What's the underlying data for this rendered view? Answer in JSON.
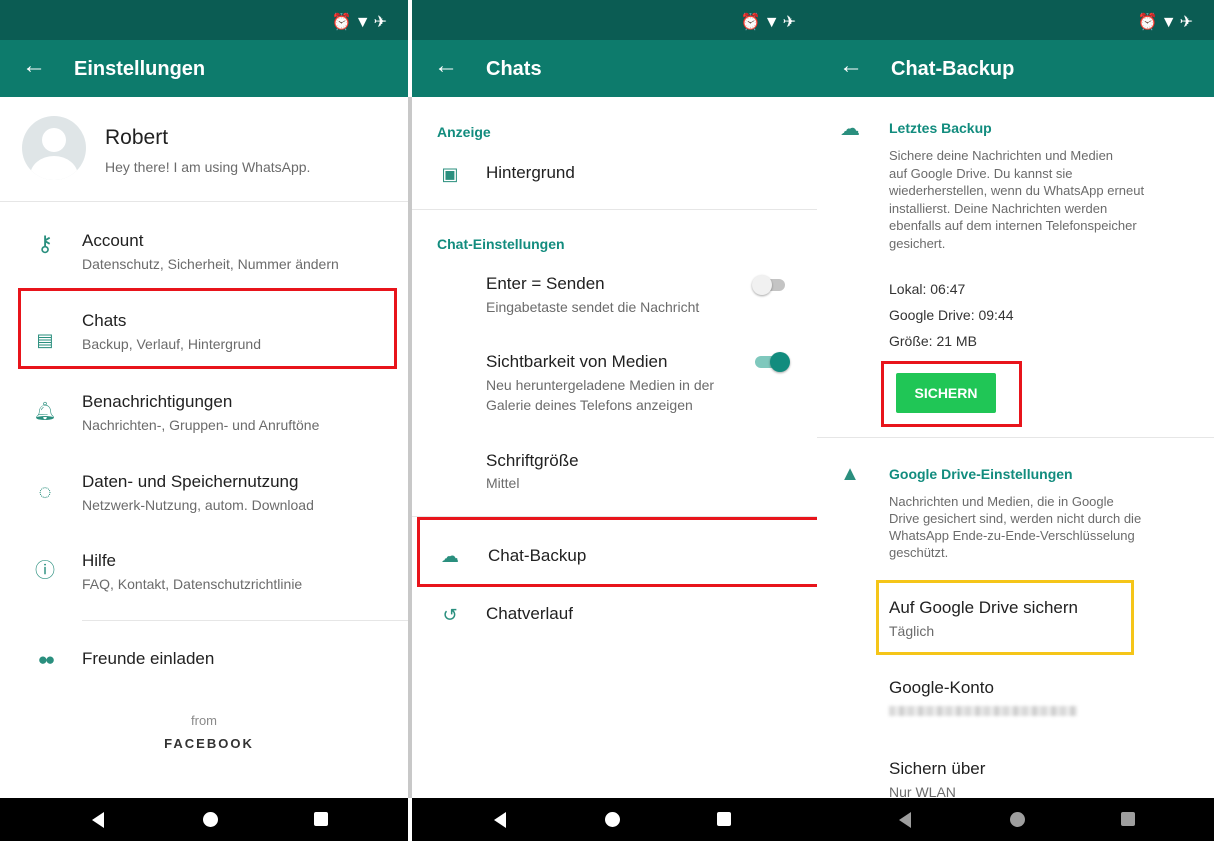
{
  "panel1": {
    "title": "Einstellungen",
    "profile": {
      "name": "Robert",
      "status": "Hey there! I am using WhatsApp."
    },
    "items": [
      {
        "icon": "key-icon",
        "label": "Account",
        "sub": "Datenschutz, Sicherheit, Nummer ändern"
      },
      {
        "icon": "chat-icon",
        "label": "Chats",
        "sub": "Backup, Verlauf, Hintergrund"
      },
      {
        "icon": "bell-icon",
        "label": "Benachrichtigungen",
        "sub": "Nachrichten-, Gruppen- und Anruftöne"
      },
      {
        "icon": "data-usage-icon",
        "label": "Daten- und Speichernutzung",
        "sub": "Netzwerk-Nutzung, autom. Download"
      },
      {
        "icon": "help-icon",
        "label": "Hilfe",
        "sub": "FAQ, Kontakt, Datenschutzrichtlinie"
      }
    ],
    "invite": "Freunde einladen",
    "footer_from": "from",
    "footer_brand": "FACEBOOK"
  },
  "panel2": {
    "title": "Chats",
    "section1": "Anzeige",
    "wallpaper": "Hintergrund",
    "section2": "Chat-Einstellungen",
    "enter_send": {
      "label": "Enter = Senden",
      "sub": "Eingabetaste sendet die Nachricht",
      "on": false
    },
    "media_visibility": {
      "label": "Sichtbarkeit von Medien",
      "sub1": "Neu heruntergeladene Medien in der",
      "sub2": "Galerie deines Telefons anzeigen",
      "on": true
    },
    "font_size": {
      "label": "Schriftgröße",
      "value": "Mittel"
    },
    "backup": "Chat-Backup",
    "history": "Chatverlauf"
  },
  "panel3": {
    "title": "Chat-Backup",
    "last_backup": {
      "heading": "Letztes Backup",
      "desc": [
        "Sichere deine Nachrichten und Medien",
        "auf Google Drive. Du kannst sie",
        "wiederherstellen, wenn du WhatsApp erneut",
        "installierst. Deine Nachrichten werden",
        "ebenfalls auf dem internen Telefonspeicher",
        "gesichert."
      ],
      "local": "Lokal: 06:47",
      "drive": "Google Drive: 09:44",
      "size": "Größe: 21 MB",
      "button": "SICHERN"
    },
    "drive_settings": {
      "heading": "Google Drive-Einstellungen",
      "desc": [
        "Nachrichten und Medien, die in Google",
        "Drive gesichert sind, werden nicht durch die",
        "WhatsApp Ende-zu-Ende-Verschlüsselung",
        "geschützt."
      ],
      "backup_to_drive": {
        "label": "Auf Google Drive sichern",
        "value": "Täglich"
      },
      "account": {
        "label": "Google-Konto"
      },
      "backup_over": {
        "label": "Sichern über",
        "value": "Nur WLAN"
      }
    }
  },
  "colors": {
    "statusbar": "#0b5c53",
    "appbar": "#0d7b6c",
    "accent": "#128c7e",
    "button": "#20c656",
    "highlight_red": "#e8141b",
    "highlight_yellow": "#f5c518"
  }
}
